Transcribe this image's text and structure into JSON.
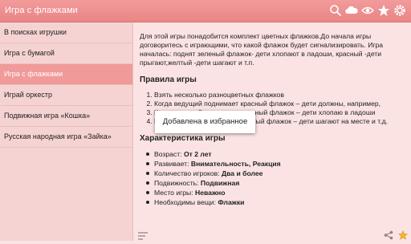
{
  "app": {
    "title": "Игра с флажками"
  },
  "toolbar_icons": [
    "search-icon",
    "cloud-icon",
    "eye-icon",
    "star-icon",
    "settings-icon"
  ],
  "sidebar": {
    "items": [
      {
        "label": "В поисках игрушки"
      },
      {
        "label": "Игра с бумагой"
      },
      {
        "label": "Игра с флажками",
        "active": true
      },
      {
        "label": "Играй оркестр"
      },
      {
        "label": "Подвижная игра «Кошка»"
      },
      {
        "label": "Русская народная игра «Зайка»"
      }
    ]
  },
  "content": {
    "intro": "Для этой игры понадобится  комплект цветных флажков.До начала игры договоритесь с играющими, что какой флажок будет сигнализировать. Игра началась: поднят зеленый флажок- дети хлопают в ладоши, красный -дети прыгают,желтый -дети шагают и т.п.",
    "rules_title": "Правила игры",
    "rules": [
      "Взять несколько разноцветных флажков",
      "Когда ведущий поднимает красный флажок – дети должны, например,",
      "Когда ведущий поднимает зеленый флажок – дети хлопаю в ладоши",
      "Когда ведущий поднимает желтый флажок – дети шагают на месте и т.д."
    ],
    "char_title": "Характеристика игры",
    "characteristics": [
      {
        "label": "Возраст: ",
        "value": "От 2 лет"
      },
      {
        "label": "Развивает: ",
        "value": "Внимательность, Реакция"
      },
      {
        "label": "Количество игроков: ",
        "value": "Два и более"
      },
      {
        "label": "Подвижность: ",
        "value": "Подвижная"
      },
      {
        "label": "Место игры: ",
        "value": "Неважно"
      },
      {
        "label": "Необходимы вещи: ",
        "value": "Флажки"
      }
    ]
  },
  "toast": {
    "text": "Добавлена в избранное"
  },
  "colors": {
    "titlebar": "#ea8585",
    "active_item": "#f09a9a",
    "background": "#fbe3e3",
    "star_active": "#f2b632"
  }
}
